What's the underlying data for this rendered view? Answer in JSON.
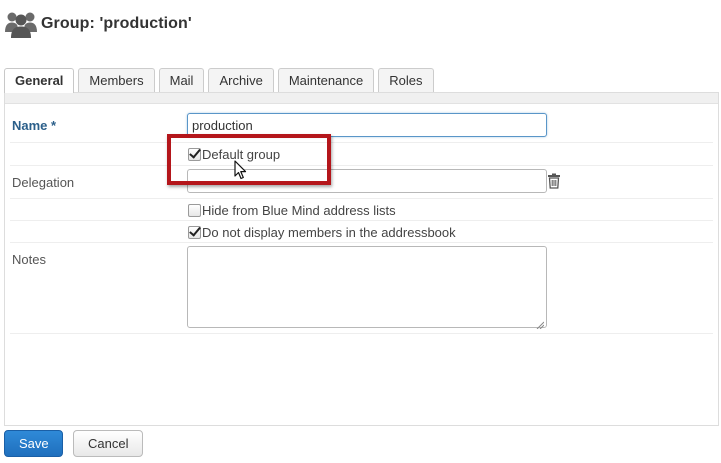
{
  "header": {
    "icon": "users-group-icon",
    "title": "Group: 'production'"
  },
  "tabs": [
    {
      "label": "General",
      "active": true
    },
    {
      "label": "Members",
      "active": false
    },
    {
      "label": "Mail",
      "active": false
    },
    {
      "label": "Archive",
      "active": false
    },
    {
      "label": "Maintenance",
      "active": false
    },
    {
      "label": "Roles",
      "active": false
    }
  ],
  "form": {
    "name_label": "Name *",
    "name_value": "production",
    "default_group_label": "Default group",
    "default_group_checked": true,
    "delegation_label": "Delegation",
    "delegation_value": "",
    "hide_label": "Hide from Blue Mind address lists",
    "hide_checked": false,
    "no_display_label": "Do not display members in the addressbook",
    "no_display_checked": true,
    "notes_label": "Notes",
    "notes_value": ""
  },
  "buttons": {
    "save_label": "Save",
    "cancel_label": "Cancel"
  },
  "colors": {
    "accent": "#1f6fbd",
    "required_label": "#2b5f8a",
    "highlight": "#b4161b"
  }
}
